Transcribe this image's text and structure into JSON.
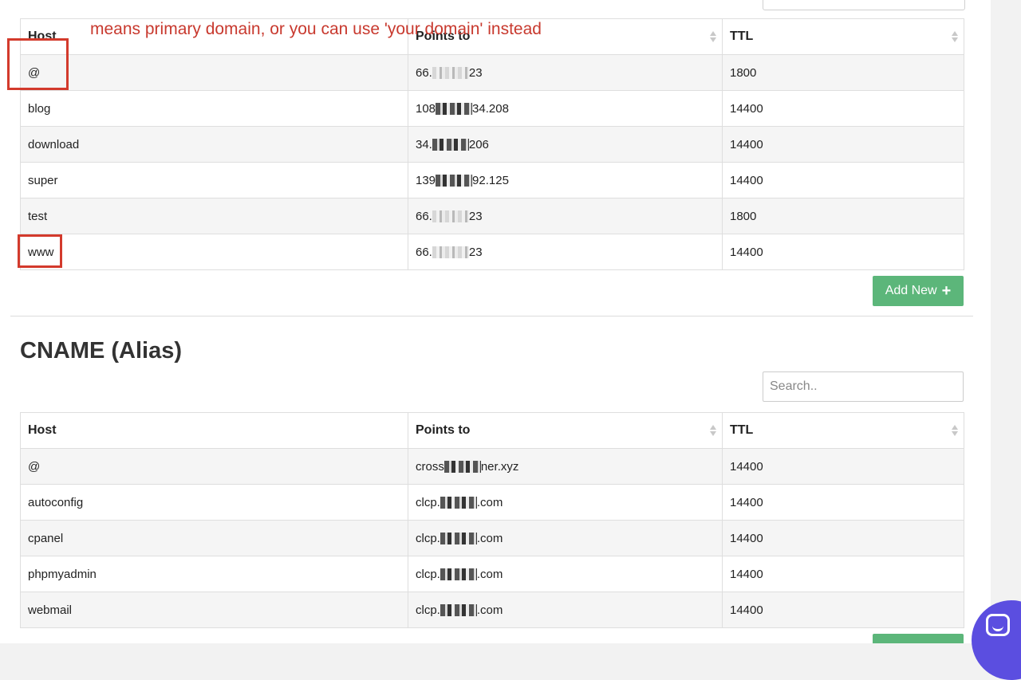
{
  "annotation": {
    "text": "means primary domain, or you can use 'your domain' instead",
    "color": "#c8392e"
  },
  "a_records": {
    "columns": [
      "Host",
      "Points to",
      "TTL"
    ],
    "rows": [
      {
        "host": "@",
        "points_prefix": "66.",
        "points_suffix": "23",
        "ttl": "1800"
      },
      {
        "host": "blog",
        "points_prefix": "108",
        "points_suffix": "34.208",
        "ttl": "14400"
      },
      {
        "host": "download",
        "points_prefix": "34.",
        "points_suffix": "206",
        "ttl": "14400"
      },
      {
        "host": "super",
        "points_prefix": "139",
        "points_suffix": "92.125",
        "ttl": "14400"
      },
      {
        "host": "test",
        "points_prefix": "66.",
        "points_suffix": "23",
        "ttl": "1800"
      },
      {
        "host": "www",
        "points_prefix": "66.",
        "points_suffix": "23",
        "ttl": "14400"
      }
    ],
    "add_button_label": "Add New"
  },
  "cname": {
    "title": "CNAME (Alias)",
    "search_placeholder": "Search..",
    "columns": [
      "Host",
      "Points to",
      "TTL"
    ],
    "rows": [
      {
        "host": "@",
        "points_prefix": "cross",
        "points_suffix": "ner.xyz",
        "ttl": "14400"
      },
      {
        "host": "autoconfig",
        "points_prefix": "clcp.",
        "points_suffix": ".com",
        "ttl": "14400"
      },
      {
        "host": "cpanel",
        "points_prefix": "clcp.",
        "points_suffix": ".com",
        "ttl": "14400"
      },
      {
        "host": "phpmyadmin",
        "points_prefix": "clcp.",
        "points_suffix": ".com",
        "ttl": "14400"
      },
      {
        "host": "webmail",
        "points_prefix": "clcp.",
        "points_suffix": ".com",
        "ttl": "14400"
      }
    ]
  },
  "icons": {
    "plus": "plus-icon",
    "sort": "sort-icon",
    "chat": "chat-icon"
  },
  "colors": {
    "accent_green": "#5cb67a",
    "annotation_red": "#d33a2c",
    "chat_purple": "#5b4ee0"
  }
}
